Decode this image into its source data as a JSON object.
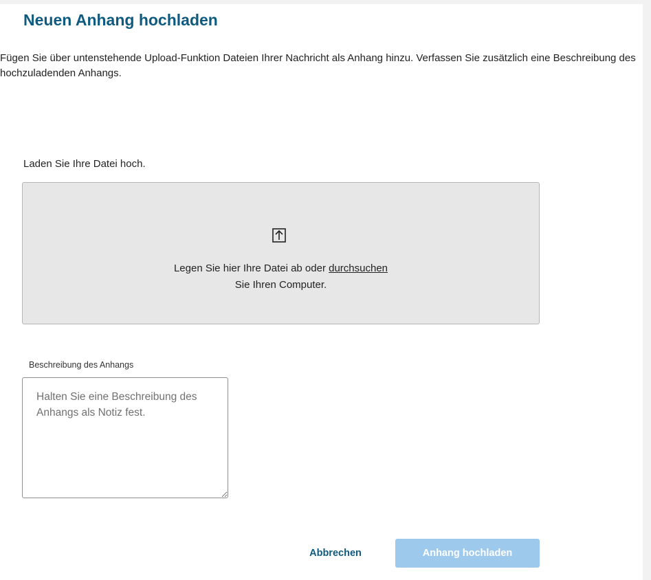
{
  "dialog": {
    "title": "Neuen Anhang hochladen",
    "intro": "Fügen Sie über untenstehende Upload-Funktion Dateien Ihrer Nachricht als Anhang hinzu. Verfassen Sie zusätzlich eine Beschreibung des hochzuladenden Anhangs."
  },
  "upload": {
    "label": "Laden Sie Ihre Datei hoch.",
    "icon": "upload-arrow-icon",
    "drop_text_before": "Legen Sie hier Ihre Datei ab oder ",
    "browse_link": "durchsuchen",
    "drop_text_after": "Sie Ihren Computer."
  },
  "description": {
    "label": "Beschreibung des Anhangs",
    "value": "",
    "placeholder": "Halten Sie eine Beschreibung des Anhangs als Notiz fest."
  },
  "actions": {
    "cancel_label": "Abbrechen",
    "upload_label": "Anhang hochladen",
    "upload_enabled": false
  },
  "colors": {
    "title": "#0f5a7f",
    "link_button": "#0f5a7f",
    "primary_disabled": "#9cc9ec",
    "dropzone_bg": "#e7e7e7",
    "page_bg": "#f2f2f2"
  }
}
